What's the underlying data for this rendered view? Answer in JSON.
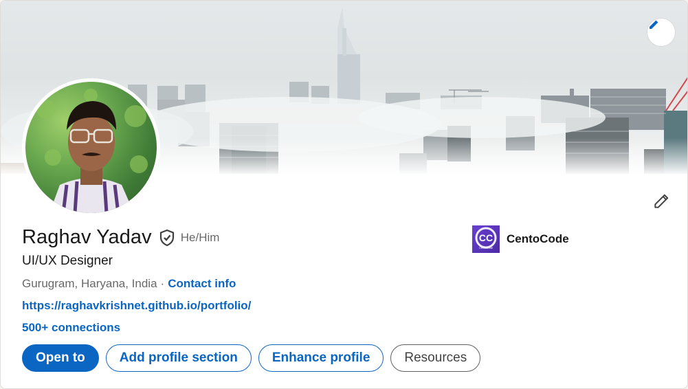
{
  "profile": {
    "name": "Raghav Yadav",
    "pronouns": "He/Him",
    "headline": "UI/UX Designer",
    "location": "Gurugram, Haryana, India",
    "separator": "·",
    "contact_info_label": "Contact info",
    "website": "https://raghavkrishnet.github.io/portfolio/",
    "connections": "500+ connections"
  },
  "company": {
    "name": "CentoCode",
    "logo_text": "CC",
    "logo_subtext": "CentoCode"
  },
  "actions": {
    "open_to": "Open to",
    "add_section": "Add profile section",
    "enhance": "Enhance profile",
    "resources": "Resources"
  },
  "icons": {
    "banner_edit": "pencil-icon",
    "profile_edit": "pencil-icon",
    "verified": "verified-shield-icon"
  },
  "colors": {
    "accent": "#0a66c2",
    "company_logo": "#5b34c0"
  }
}
